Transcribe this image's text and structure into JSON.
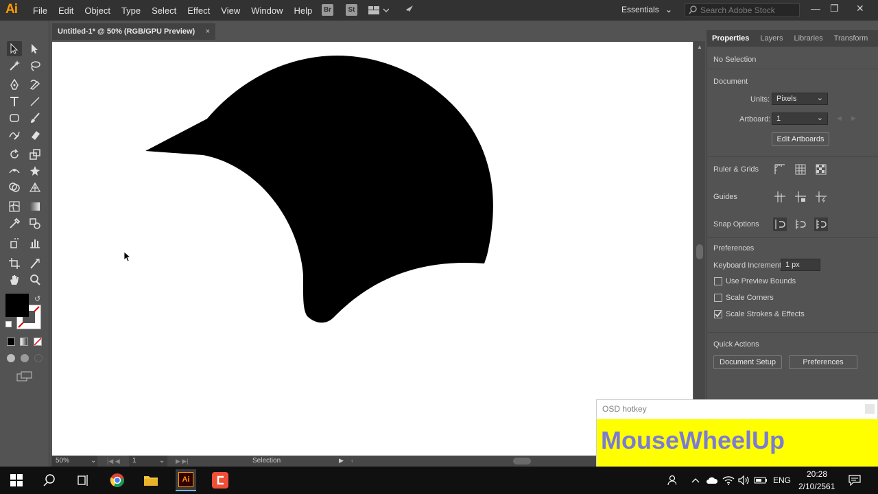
{
  "app": {
    "logo": "Ai",
    "menu": [
      "File",
      "Edit",
      "Object",
      "Type",
      "Select",
      "Effect",
      "View",
      "Window",
      "Help"
    ],
    "bridge_btn": "Br",
    "stock_btn": "St",
    "workspace": "Essentials",
    "search_placeholder": "Search Adobe Stock",
    "window_controls": [
      "minimize-icon",
      "restore-icon",
      "close-icon"
    ]
  },
  "document_tab": {
    "title": "Untitled-1* @ 50% (RGB/GPU Preview)",
    "close": "×"
  },
  "status_bar": {
    "zoom": "50%",
    "artboard_number": "1",
    "tool_name": "Selection"
  },
  "right_panel": {
    "tabs": [
      "Properties",
      "Layers",
      "Libraries",
      "Transform"
    ],
    "no_selection": "No Selection",
    "document_heading": "Document",
    "units_label": "Units:",
    "units_value": "Pixels",
    "artboard_label": "Artboard:",
    "artboard_value": "1",
    "edit_artboards": "Edit Artboards",
    "ruler_grids": "Ruler & Grids",
    "guides": "Guides",
    "snap_options": "Snap Options",
    "preferences_heading": "Preferences",
    "keyboard_increment_label": "Keyboard Increment:",
    "keyboard_increment_value": "1 px",
    "use_preview_bounds": "Use Preview Bounds",
    "scale_corners": "Scale Corners",
    "scale_strokes_effects": "Scale Strokes & Effects",
    "checkbox_state": {
      "use_preview_bounds": false,
      "scale_corners": false,
      "scale_strokes_effects": true
    },
    "quick_actions": "Quick Actions",
    "document_setup": "Document Setup",
    "preferences_btn": "Preferences"
  },
  "osd": {
    "title": "OSD hotkey",
    "text": "MouseWheelUp"
  },
  "taskbar": {
    "lang": "ENG",
    "time": "20:28",
    "date": "2/10/2561"
  },
  "colors": {
    "accent": "#ff9a00",
    "artboard": "#ffffff",
    "shape": "#000000",
    "osd_bg": "#ffff00",
    "osd_text": "#7b7bd6"
  }
}
